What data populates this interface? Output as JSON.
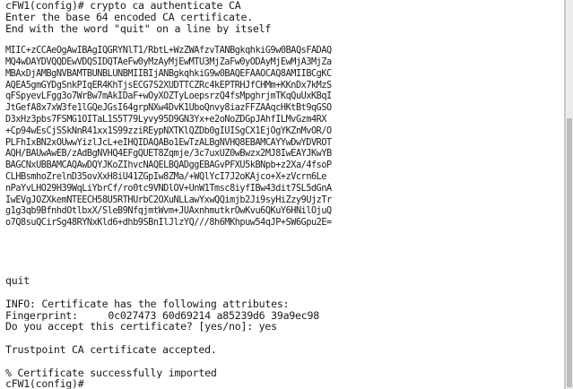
{
  "terminal": {
    "lines": [
      "cFW1(config)# crypto ca authenticate CA",
      "Enter the base 64 encoded CA certificate.",
      "End with the word \"quit\" on a line by itself",
      "",
      "MIIC+zCCAeOgAwIBAgIQGRYNlT1/RbtL+WzZWAfzvTANBgkqhkiG9w0BAQsFADAQ",
      "MQ4wDAYDVQQDEwVDQSIDQTAeFw0yMzAyMjEwMTU3MjZaFw0yODAyMjEwMjA3MjZa",
      "MBAxDjAMBgNVBAMTBUNBLUNBMIIBIjANBgkqhkiG9w0BAQEFAAOCAQ8AMIIBCgKC",
      "AQEA5gmGYDgSnkPIqER4KhTjsECG7S2XUDTTCZRc4kEPTRHJfCHMm+KKnDx7kMzS",
      "qFSpyevLFgg3o7WrBw7mAkIDaF+wOyXOZTyLoepsrzQ4fsMpghrjmTKqQuUxKBqI",
      "JtGefA8x7xW3fe1lGQeJGsI64grpNXw4DvK1UboQnvy8iazFFZAAqcHKtBt9qGSO",
      "D3xHz3pbs7FSMG1OITaL1S5T79Lyvy95D9GN3Yx+e2oNoZDGpJAhfILMvGzm4RX",
      "+Cp94wEsCjSSkNnR41xx1S99zziREypNXTKlQZDb0gIUISgCX1EjOgYKZnMvOR/O",
      "PLFhIxBN2xOUwwYizlJcL+eIHQIDAQABo1EwTzALBgNVHQ8EBAMCAYYwDwYDVROT",
      "AQH/BAUwAwEB/zAdBgNVHQ4EFgQUET8Zqmje/3c7uxUZ0wBwzx2MJ8IwEAYJKwYB",
      "BAGCNxUBBAMCAQAwDQYJKoZIhvcNAQELBQADggEBAGvPFXU5kBNpb+z2Xa/4fsoP",
      "CLHBsmhoZrelnD35ovXxH8iU41ZGpIw8ZMa/+WQlYcI7J2oKAjco+X+zVcrn6Le",
      "nPaYvLHO29H39WqLiYbrCf/ro0tc9VNDlOV+UnW1Tmsc8iyfIBw43dit7SL5dGnA",
      "IwEVgJOZXkemNTEECH58U5RTHUrbC2OXuNLLawYxwQQimjb2Ji9syHiZzy9UjzTr",
      "g1g3qb9BfnhdOtlbxX/SleB9NfqjmtWvm+JUAxnhmutkrOwKvu6QKuY6HNilOjuQ",
      "o7Q8suQCirSg48RYNxKld6+dhb9SBnIlJlzYQ///8h6MKhpuw54qJP+SW6Gpu2E=",
      "",
      "",
      "",
      "",
      "quit",
      "",
      "INFO: Certificate has the following attributes:",
      "Fingerprint:     0c027473 60d69214 a85239d6 39a9ec98",
      "Do you accept this certificate? [yes/no]: yes",
      "",
      "Trustpoint CA certificate accepted.",
      "",
      "% Certificate successfully imported",
      "cFW1(config)#"
    ]
  },
  "colors": {
    "background": "#ffffff",
    "text": "#1a1a1a",
    "scrollbar": "#ececec"
  }
}
